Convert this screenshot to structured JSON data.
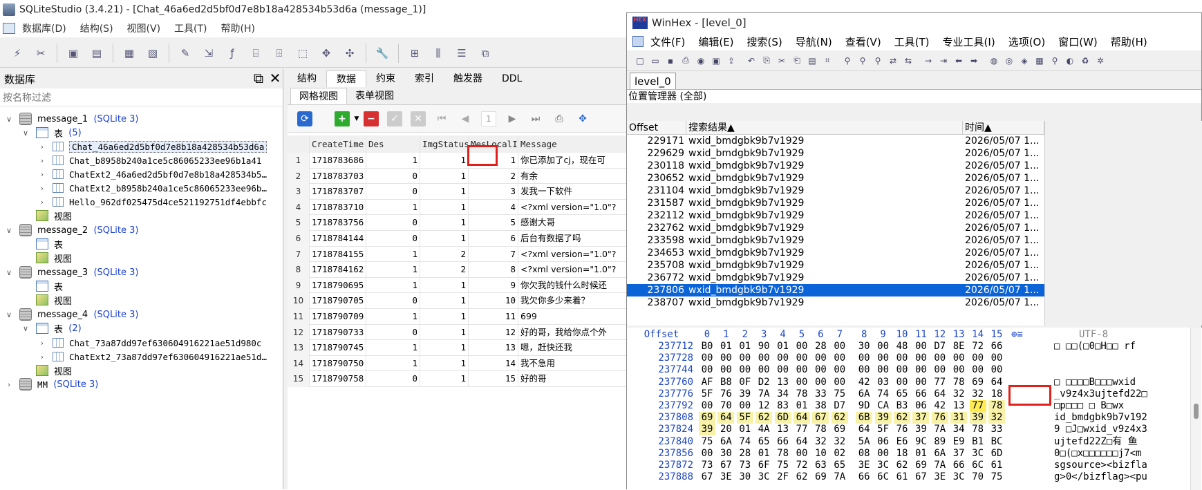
{
  "sqlite": {
    "title": "SQLiteStudio (3.4.21) - [Chat_46a6ed2d5bf0d7e8b18a428534b53d6a (message_1)]",
    "menu": [
      "数据库(D)",
      "结构(S)",
      "视图(V)",
      "工具(T)",
      "帮助(H)"
    ],
    "db_panel": {
      "title": "数据库",
      "filter_placeholder": "按名称过滤",
      "tree": [
        {
          "label": "message_1",
          "tag": "(SQLite 3)"
        },
        {
          "label": "表",
          "count": "(5)"
        },
        {
          "label": "Chat_46a6ed2d5bf0d7e8b18a428534b53d6a"
        },
        {
          "label": "Chat_b8958b240a1ce5c86065233ee96b1a41"
        },
        {
          "label": "ChatExt2_46a6ed2d5bf0d7e8b18a428534b5…"
        },
        {
          "label": "ChatExt2_b8958b240a1ce5c86065233ee96b…"
        },
        {
          "label": "Hello_962df025475d4ce521192751df4ebbfc"
        },
        {
          "label": "视图"
        },
        {
          "label": "message_2",
          "tag": "(SQLite 3)"
        },
        {
          "label": "表"
        },
        {
          "label": "视图"
        },
        {
          "label": "message_3",
          "tag": "(SQLite 3)"
        },
        {
          "label": "表"
        },
        {
          "label": "视图"
        },
        {
          "label": "message_4",
          "tag": "(SQLite 3)"
        },
        {
          "label": "表",
          "count": "(2)"
        },
        {
          "label": "Chat_73a87dd97ef630604916221ae51d980c"
        },
        {
          "label": "ChatExt2_73a87dd97ef630604916221ae51d…"
        },
        {
          "label": "视图"
        },
        {
          "label": "MM",
          "tag": "(SQLite 3)"
        }
      ]
    },
    "editor": {
      "tabs": [
        "结构",
        "数据",
        "约束",
        "索引",
        "触发器",
        "DDL"
      ],
      "subtabs": [
        "网格视图",
        "表单视图"
      ],
      "page_number": "1",
      "columns": [
        "CreateTime",
        "Des",
        "ImgStatus",
        "MesLocalI",
        "Message"
      ],
      "rows": [
        [
          "1",
          "1718783686",
          "1",
          "1",
          "1",
          "你已添加了cj，现在可"
        ],
        [
          "2",
          "1718783703",
          "0",
          "1",
          "2",
          "有余"
        ],
        [
          "3",
          "1718783707",
          "0",
          "1",
          "3",
          "发我一下软件"
        ],
        [
          "4",
          "1718783710",
          "1",
          "1",
          "4",
          "<?xml version=\"1.0\"?"
        ],
        [
          "5",
          "1718783756",
          "0",
          "1",
          "5",
          "感谢大哥"
        ],
        [
          "6",
          "1718784144",
          "0",
          "1",
          "6",
          "后台有数据了吗"
        ],
        [
          "7",
          "1718784155",
          "1",
          "2",
          "7",
          "<?xml version=\"1.0\"?"
        ],
        [
          "8",
          "1718784162",
          "1",
          "2",
          "8",
          "<?xml version=\"1.0\"?"
        ],
        [
          "9",
          "1718790695",
          "1",
          "1",
          "9",
          "你欠我的钱什么时候还"
        ],
        [
          "10",
          "1718790705",
          "0",
          "1",
          "10",
          "我欠你多少来着？"
        ],
        [
          "11",
          "1718790709",
          "1",
          "1",
          "11",
          "699"
        ],
        [
          "12",
          "1718790733",
          "0",
          "1",
          "12",
          "好的哥，我给你点个外"
        ],
        [
          "13",
          "1718790745",
          "1",
          "1",
          "13",
          "嗯，赶快还我"
        ],
        [
          "14",
          "1718790750",
          "1",
          "1",
          "14",
          "我不急用"
        ],
        [
          "15",
          "1718790758",
          "0",
          "1",
          "15",
          "好的哥"
        ]
      ]
    }
  },
  "winhex": {
    "title": "WinHex - [level_0]",
    "logo_text": "HEX",
    "menu": [
      "文件(F)",
      "编辑(E)",
      "搜索(S)",
      "导航(N)",
      "查看(V)",
      "工具(T)",
      "专业工具(I)",
      "选项(O)",
      "窗口(W)",
      "帮助(H)"
    ],
    "tab": "level_0",
    "position_manager": "位置管理器 (全部)",
    "result_headers": [
      "Offset",
      "搜索结果▲",
      "时间▲"
    ],
    "results": [
      [
        "229171",
        "wxid_bmdgbk9b7v1929",
        "2026/05/07  1..."
      ],
      [
        "229629",
        "wxid_bmdgbk9b7v1929",
        "2026/05/07  1..."
      ],
      [
        "230118",
        "wxid_bmdgbk9b7v1929",
        "2026/05/07  1..."
      ],
      [
        "230652",
        "wxid_bmdgbk9b7v1929",
        "2026/05/07  1..."
      ],
      [
        "231104",
        "wxid_bmdgbk9b7v1929",
        "2026/05/07  1..."
      ],
      [
        "231587",
        "wxid_bmdgbk9b7v1929",
        "2026/05/07  1..."
      ],
      [
        "232112",
        "wxid_bmdgbk9b7v1929",
        "2026/05/07  1..."
      ],
      [
        "232762",
        "wxid_bmdgbk9b7v1929",
        "2026/05/07  1..."
      ],
      [
        "233598",
        "wxid_bmdgbk9b7v1929",
        "2026/05/07  1..."
      ],
      [
        "234653",
        "wxid_bmdgbk9b7v1929",
        "2026/05/07  1..."
      ],
      [
        "235708",
        "wxid_bmdgbk9b7v1929",
        "2026/05/07  1..."
      ],
      [
        "236772",
        "wxid_bmdgbk9b7v1929",
        "2026/05/07  1..."
      ],
      [
        "237806",
        "wxid_bmdgbk9b7v1929",
        "2026/05/07  1..."
      ],
      [
        "238707",
        "wxid_bmdgbk9b7v1929",
        "2026/05/07  1..."
      ]
    ],
    "selected_result": 12,
    "hex_header": {
      "offset": "Offset",
      "cols": [
        "0",
        "1",
        "2",
        "3",
        "4",
        "5",
        "6",
        "7",
        "8",
        "9",
        "10",
        "11",
        "12",
        "13",
        "14",
        "15"
      ],
      "encoding": "UTF-8"
    },
    "hex_rows": [
      {
        "off": "237712",
        "b": [
          "B0",
          "01",
          "01",
          "90",
          "01",
          "00",
          "28",
          "00",
          "30",
          "00",
          "48",
          "00",
          "D7",
          "8E",
          "72",
          "66"
        ],
        "a": "  □  □□(□0□H□□ rf"
      },
      {
        "off": "237728",
        "b": [
          "00",
          "00",
          "00",
          "00",
          "00",
          "00",
          "00",
          "00",
          "00",
          "00",
          "00",
          "00",
          "00",
          "00",
          "00",
          "00"
        ],
        "a": ""
      },
      {
        "off": "237744",
        "b": [
          "00",
          "00",
          "00",
          "00",
          "00",
          "00",
          "00",
          "00",
          "00",
          "00",
          "00",
          "00",
          "00",
          "00",
          "00",
          "00"
        ],
        "a": ""
      },
      {
        "off": "237760",
        "b": [
          "AF",
          "B8",
          "0F",
          "D2",
          "13",
          "00",
          "00",
          "00",
          "42",
          "03",
          "00",
          "00",
          "77",
          "78",
          "69",
          "64"
        ],
        "a": "□   □□□□B□□□wxid"
      },
      {
        "off": "237776",
        "b": [
          "5F",
          "76",
          "39",
          "7A",
          "34",
          "78",
          "33",
          "75",
          "6A",
          "74",
          "65",
          "66",
          "64",
          "32",
          "32",
          "18"
        ],
        "a": "_v9z4x3ujtefd22□"
      },
      {
        "off": "237792",
        "b": [
          "00",
          "70",
          "00",
          "12",
          "83",
          "01",
          "38",
          "D7",
          "9D",
          "CA",
          "B3",
          "06",
          "42",
          "13",
          "77",
          "78"
        ],
        "a": "□p□□□   □   B□wx"
      },
      {
        "off": "237808",
        "b": [
          "69",
          "64",
          "5F",
          "62",
          "6D",
          "64",
          "67",
          "62",
          "6B",
          "39",
          "62",
          "37",
          "76",
          "31",
          "39",
          "32"
        ],
        "a": "id_bmdgbk9b7v192"
      },
      {
        "off": "237824",
        "b": [
          "39",
          "20",
          "01",
          "4A",
          "13",
          "77",
          "78",
          "69",
          "64",
          "5F",
          "76",
          "39",
          "7A",
          "34",
          "78",
          "33"
        ],
        "a": "9 □J□wxid_v9z4x3"
      },
      {
        "off": "237840",
        "b": [
          "75",
          "6A",
          "74",
          "65",
          "66",
          "64",
          "32",
          "32",
          "5A",
          "06",
          "E6",
          "9C",
          "89",
          "E9",
          "B1",
          "BC"
        ],
        "a": "ujtefd22Z□有 鱼"
      },
      {
        "off": "237856",
        "b": [
          "00",
          "30",
          "28",
          "01",
          "78",
          "00",
          "10",
          "02",
          "08",
          "00",
          "18",
          "01",
          "6A",
          "37",
          "3C",
          "6D"
        ],
        "a": "0□(□x□□□□□□j7<m"
      },
      {
        "off": "237872",
        "b": [
          "73",
          "67",
          "73",
          "6F",
          "75",
          "72",
          "63",
          "65",
          "3E",
          "3C",
          "62",
          "69",
          "7A",
          "66",
          "6C",
          "61"
        ],
        "a": "sgsource><bizfla"
      },
      {
        "off": "237888",
        "b": [
          "67",
          "3E",
          "30",
          "3C",
          "2F",
          "62",
          "69",
          "7A",
          "66",
          "6C",
          "61",
          "67",
          "3E",
          "3C",
          "70",
          "75"
        ],
        "a": "g>0</bizflag><pu"
      }
    ]
  }
}
